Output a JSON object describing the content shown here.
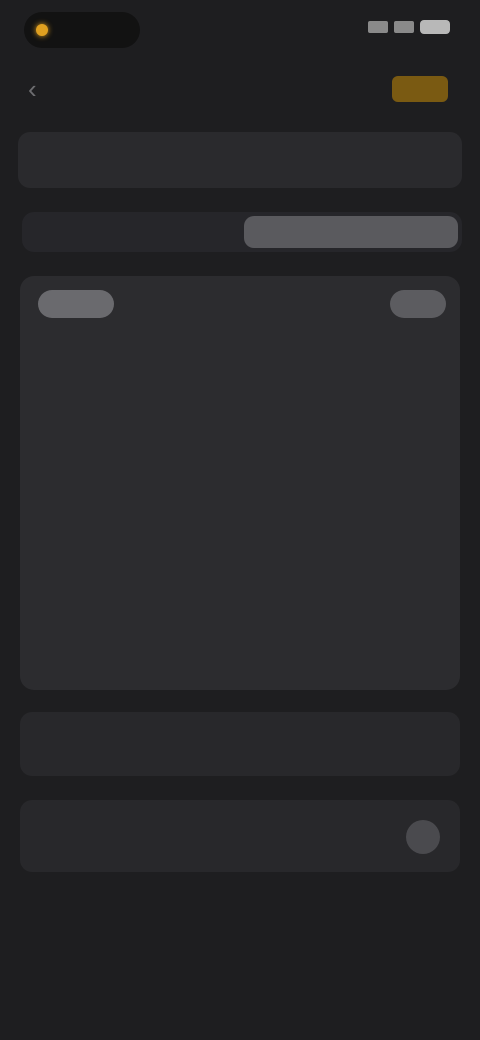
{
  "status_bar": {
    "pill_label": "",
    "time": ""
  },
  "nav": {
    "back_icon": "chevron-left-icon",
    "title": "",
    "done_label": ""
  },
  "search": {
    "placeholder": ""
  },
  "segmented": {
    "left_label": "",
    "right_label": ""
  },
  "grid": {
    "header_label": "",
    "action_label": "",
    "caption": ""
  },
  "rows": {
    "row1_label": "",
    "row1_value": "",
    "row2_label": ""
  },
  "colors": {
    "accent": "#e0a020",
    "accent_button_bg": "#7a5a12",
    "background": "#1e1e20",
    "card": "#2c2c2f"
  }
}
